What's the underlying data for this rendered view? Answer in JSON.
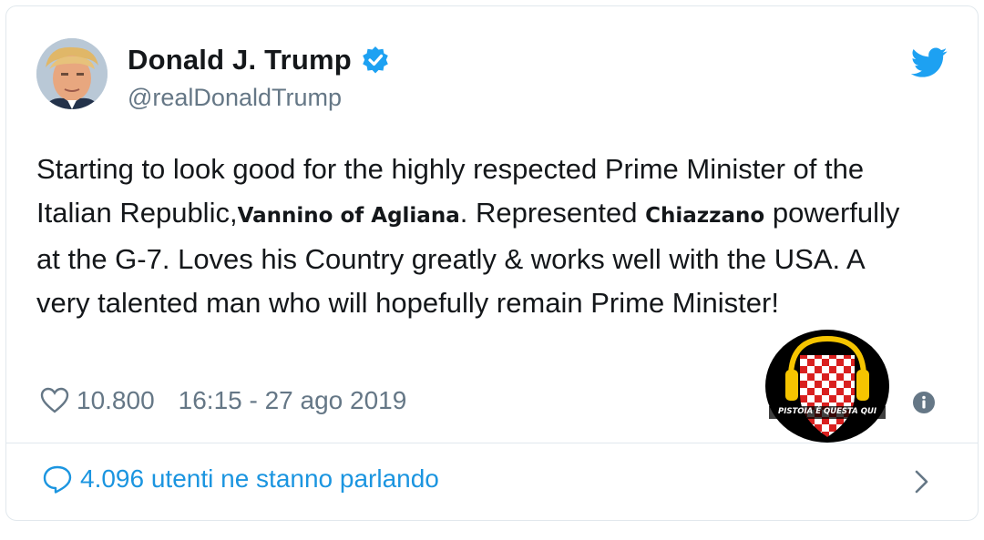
{
  "user": {
    "display_name": "Donald J. Trump",
    "handle": "@realDonaldTrump",
    "verified": true
  },
  "tweet": {
    "text_part1": "Starting to look good for the highly respected Prime Minister of the Italian Republic,",
    "insert1": "Vannino of Agliana",
    "text_part2": ". Represented ",
    "insert2": "Chiazzano",
    "text_part3": " powerfully at the G-7. Loves his Country greatly & works well with the USA. A very talented man who will hopefully remain Prime Minister!"
  },
  "meta": {
    "likes": "10.800",
    "timestamp": "16:15 - 27 ago 2019"
  },
  "overlay_logo": {
    "text": "PISTOIA È QUESTA QUI"
  },
  "footer": {
    "conversation": "4.096 utenti ne stanno parlando"
  },
  "colors": {
    "brand_blue": "#1da1f2",
    "link_blue": "#1b95e0",
    "secondary_text": "#657786",
    "logo_red": "#d9201f",
    "headphone_yellow": "#f5c400"
  },
  "icons": [
    "verified-badge-icon",
    "twitter-bird-icon",
    "heart-icon",
    "info-icon",
    "speech-bubble-icon",
    "chevron-right-icon"
  ]
}
